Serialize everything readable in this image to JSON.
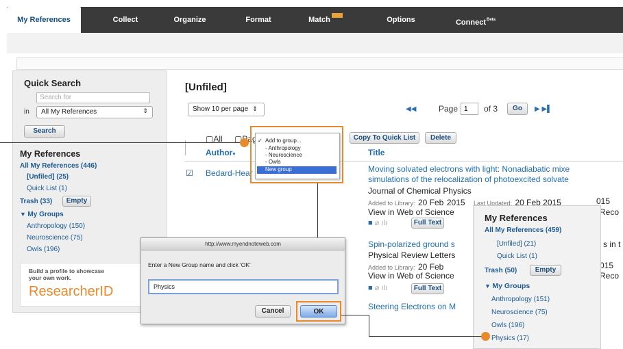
{
  "nav": {
    "tabs": [
      {
        "label": "My References",
        "active": true
      },
      {
        "label": "Collect"
      },
      {
        "label": "Organize"
      },
      {
        "label": "Format"
      },
      {
        "label": "Match"
      },
      {
        "label": "Options"
      },
      {
        "label": "Connect"
      }
    ],
    "beta_label": "Beta",
    "new_badge_color": "#e8a23a"
  },
  "sidebar": {
    "quick_search_title": "Quick Search",
    "search_placeholder": "Search for",
    "in_label": "in",
    "scope_value": "All My References",
    "search_button": "Search",
    "my_refs_title": "My References",
    "all_refs": "All My References (446)",
    "unfiled": "[Unfiled] (25)",
    "quick_list": "Quick List (1)",
    "trash": "Trash (33)",
    "empty_button": "Empty",
    "my_groups": "My Groups",
    "groups": [
      "Anthropology (150)",
      "Neuroscience (75)",
      "Owls (196)"
    ],
    "profile_text": "Build a profile to showcase your own work.",
    "researcher_id": "ResearcherID"
  },
  "main": {
    "title": "[Unfiled]",
    "per_page": "Show 10 per page",
    "page_label": "Page",
    "page_value": "1",
    "of_pages": "of 3",
    "go_button": "Go",
    "all_label": "All",
    "page_checkbox_label": "Page",
    "copy_quick_list": "Copy To Quick List",
    "delete_button": "Delete",
    "col_author": "Author",
    "col_title": "Title",
    "refs": [
      {
        "author": "Bedard-Hear",
        "title_line1": "Moving solvated electrons with light: Nonadiabatic mixe",
        "title_line2": "simulations of the relocalization of photoexcited solvate",
        "journal": "Journal of Chemical Physics",
        "added_label": "Added to Library:",
        "added_date": "20 Feb",
        "added_suffix": "2015",
        "updated_label": "Last Updated:",
        "updated_value": "20 Feb 2015",
        "wos": "View in Web of Science",
        "wos_suffix": "Reco",
        "full_text": "Full Text"
      },
      {
        "title_line1": "Spin-polarized ground s",
        "title_suffix": "s in t",
        "journal": "Physical Review Letters",
        "added_label": "Added to Library:",
        "added_date": "20 Feb",
        "added_suffix": "015",
        "wos": "View in Web of Science",
        "wos_suffix": "Reco",
        "full_text": "Full Text"
      },
      {
        "title_line1": "Steering Electrons on M"
      }
    ]
  },
  "menu": {
    "items": [
      "Add to group...",
      "- Anthropology",
      "- Neuroscience",
      "- Owls",
      "New group"
    ],
    "checkmark": "✓",
    "highlight_color": "#3b6fd6"
  },
  "dialog": {
    "title": "http://www.myendnoteweb.com",
    "prompt": "Enter a New Group name and click 'OK'",
    "input_value": "Physics",
    "cancel": "Cancel",
    "ok": "OK"
  },
  "popup": {
    "title": "My References",
    "all_refs": "All My References (459)",
    "unfiled": "[Unfiled] (21)",
    "quick_list": "Quick List (1)",
    "trash": "Trash (50)",
    "empty": "Empty",
    "my_groups": "My Groups",
    "groups": [
      "Anthropology (151)",
      "Neuroscience (75)",
      "Owls (196)",
      "Physics (17)"
    ]
  },
  "accent_color": "#e8892b"
}
